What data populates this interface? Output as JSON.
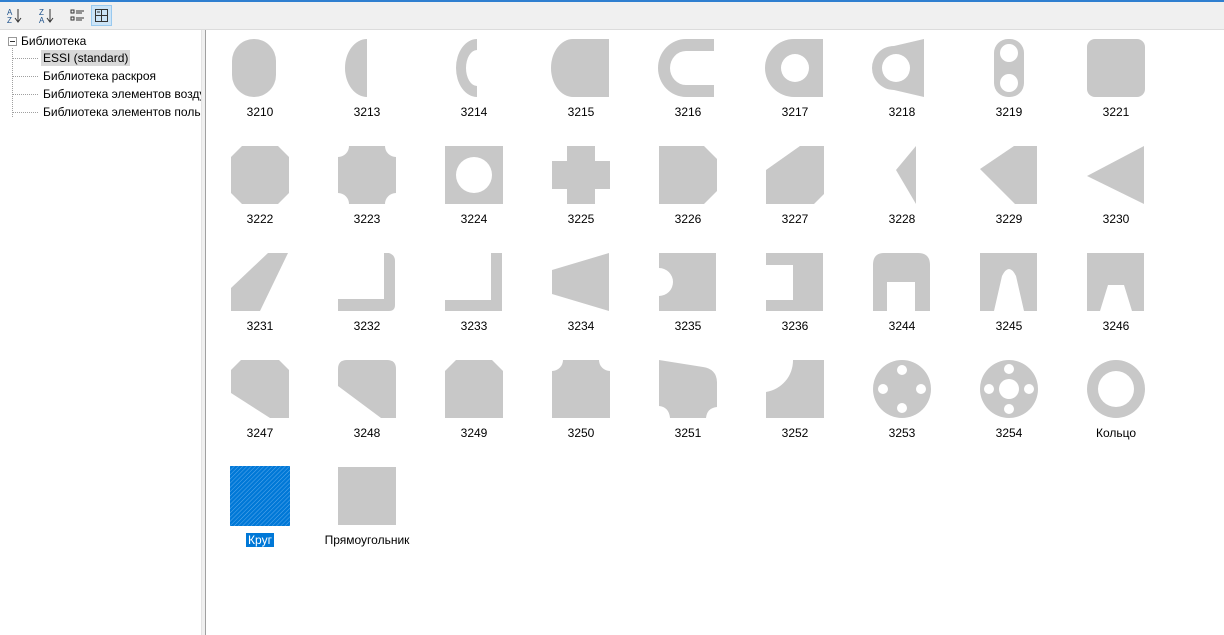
{
  "colors": {
    "shape_fill": "#c8c8c8",
    "selection": "#0078d7",
    "toolbar_accent": "#2f7fd0"
  },
  "toolbar": {
    "buttons": [
      {
        "name": "sort-ascending-icon",
        "active": false
      },
      {
        "name": "sort-descending-icon",
        "active": false
      },
      {
        "name": "details-view-icon",
        "active": false
      },
      {
        "name": "large-icons-view-icon",
        "active": true
      }
    ]
  },
  "tree": {
    "root": {
      "label": "Библиотека",
      "expanded": true
    },
    "items": [
      {
        "label": "ESSI (standard)",
        "selected": true
      },
      {
        "label": "Библиотека раскроя"
      },
      {
        "label": "Библиотека элементов возду"
      },
      {
        "label": "Библиотека элементов поль"
      }
    ]
  },
  "shapes": [
    {
      "label": "3210",
      "icon": "stadium-shape-icon"
    },
    {
      "label": "3213",
      "icon": "half-disc-shape-icon"
    },
    {
      "label": "3214",
      "icon": "crescent-shape-icon"
    },
    {
      "label": "3215",
      "icon": "d-shape-icon"
    },
    {
      "label": "3216",
      "icon": "u-shape-icon"
    },
    {
      "label": "3217",
      "icon": "tab-with-hole-shape-icon"
    },
    {
      "label": "3218",
      "icon": "trapezoid-with-hole-shape-icon"
    },
    {
      "label": "3219",
      "icon": "slot-two-holes-shape-icon"
    },
    {
      "label": "3221",
      "icon": "rounded-square-shape-icon"
    },
    {
      "label": "3222",
      "icon": "octagon-shape-icon"
    },
    {
      "label": "3223",
      "icon": "concave-corners-shape-icon"
    },
    {
      "label": "3224",
      "icon": "square-with-hole-shape-icon"
    },
    {
      "label": "3225",
      "icon": "cross-shape-icon"
    },
    {
      "label": "3226",
      "icon": "chamfered-right-shape-icon"
    },
    {
      "label": "3227",
      "icon": "pentagon-shape-icon"
    },
    {
      "label": "3228",
      "icon": "narrow-triangle-shape-icon"
    },
    {
      "label": "3229",
      "icon": "cut-triangle-shape-icon"
    },
    {
      "label": "3230",
      "icon": "left-triangle-shape-icon"
    },
    {
      "label": "3231",
      "icon": "parallelogram-shape-icon"
    },
    {
      "label": "3232",
      "icon": "angle-rounded-shape-icon"
    },
    {
      "label": "3233",
      "icon": "angle-shape-icon"
    },
    {
      "label": "3234",
      "icon": "trapezoid-left-shape-icon"
    },
    {
      "label": "3235",
      "icon": "notched-square-shape-icon"
    },
    {
      "label": "3236",
      "icon": "c-channel-shape-icon"
    },
    {
      "label": "3244",
      "icon": "arch-notch-shape-icon"
    },
    {
      "label": "3245",
      "icon": "rounded-notch-shape-icon"
    },
    {
      "label": "3246",
      "icon": "v-notch-shape-icon"
    },
    {
      "label": "3247",
      "icon": "chamfered-left-shape-icon"
    },
    {
      "label": "3248",
      "icon": "rounded-chamfer-shape-icon"
    },
    {
      "label": "3249",
      "icon": "double-corner-shape-icon"
    },
    {
      "label": "3250",
      "icon": "scalloped-square-shape-icon"
    },
    {
      "label": "3251",
      "icon": "skewed-square-shape-icon"
    },
    {
      "label": "3252",
      "icon": "quarter-cut-shape-icon"
    },
    {
      "label": "3253",
      "icon": "flange-four-holes-shape-icon"
    },
    {
      "label": "3254",
      "icon": "flange-center-hole-shape-icon"
    },
    {
      "label": "Кольцо",
      "icon": "ring-shape-icon"
    },
    {
      "label": "Круг",
      "icon": "circle-shape-icon",
      "selected": true
    },
    {
      "label": "Прямоугольник",
      "icon": "rectangle-shape-icon"
    }
  ]
}
